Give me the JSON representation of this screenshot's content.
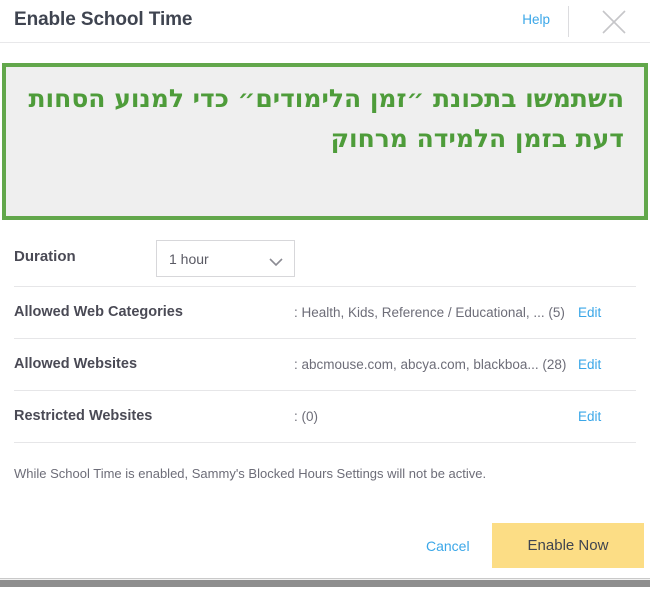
{
  "window": {
    "title": "Enable School Time",
    "help_label": "Help",
    "close_icon": "close-icon"
  },
  "callout": {
    "text": "השתמשו בתכונת ״זמן הלימודים״ כדי למנוע הסחות דעת בזמן הלמידה מרחוק",
    "border_color": "#62a74b",
    "text_color": "#4e9c3a",
    "background_color": "#efefef"
  },
  "duration": {
    "label": "Duration",
    "selected": "1 hour",
    "chevron_icon": "chevron-down-icon"
  },
  "settings": [
    {
      "label": "Allowed Web Categories",
      "value": ": Health, Kids, Reference / Educational, ...",
      "count": "(5)",
      "edit_label": "Edit"
    },
    {
      "label": "Allowed Websites",
      "value": ": abcmouse.com, abcya.com, blackboa...",
      "count": "(28)",
      "edit_label": "Edit"
    },
    {
      "label": "Restricted Websites",
      "value": ": (0)",
      "count": "",
      "edit_label": "Edit"
    }
  ],
  "note": "While School Time is enabled, Sammy's Blocked Hours Settings will not be active.",
  "footer": {
    "cancel_label": "Cancel",
    "enable_label": "Enable Now",
    "enable_color": "#fcdd85",
    "link_color": "#3ba7e8"
  }
}
